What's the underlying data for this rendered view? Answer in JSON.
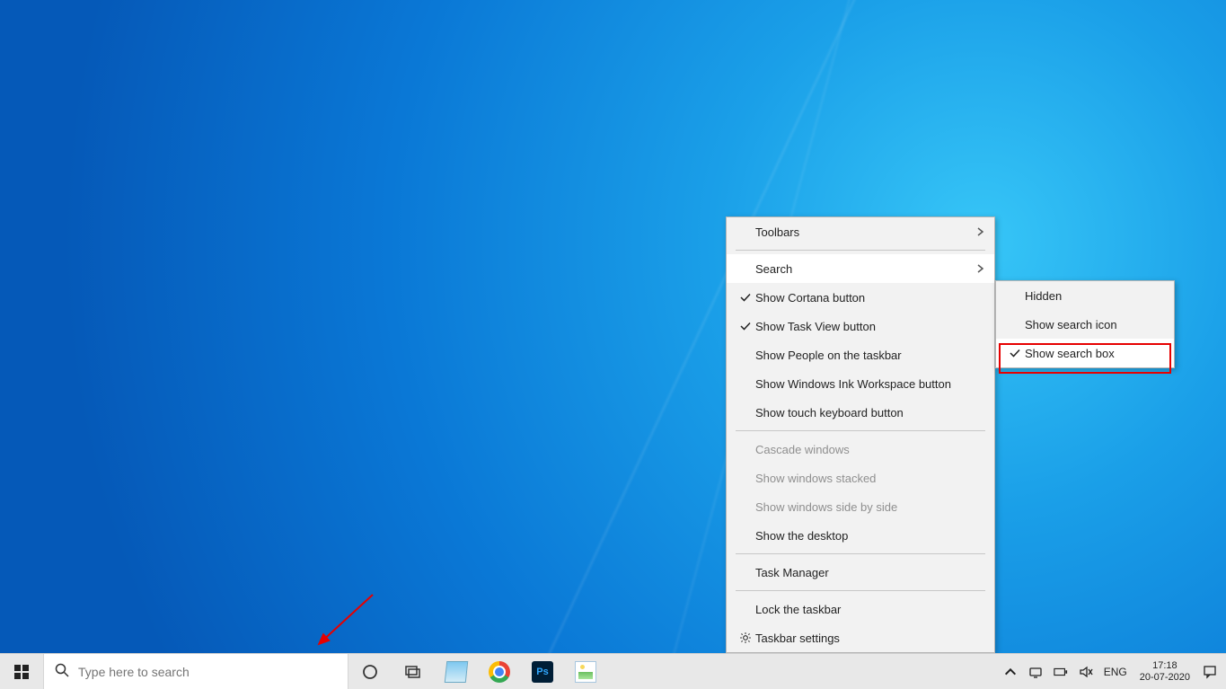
{
  "taskbar": {
    "search_placeholder": "Type here to search",
    "apps": [
      {
        "name": "notepad-app",
        "label": "Notepad"
      },
      {
        "name": "chrome-app",
        "label": "Google Chrome"
      },
      {
        "name": "photoshop-app",
        "label": "Ps"
      },
      {
        "name": "photos-app",
        "label": "Photos"
      }
    ]
  },
  "tray": {
    "language": "ENG",
    "time": "17:18",
    "date": "20-07-2020"
  },
  "context_menu": {
    "toolbars": "Toolbars",
    "search": "Search",
    "show_cortana": "Show Cortana button",
    "show_task_view": "Show Task View button",
    "show_people": "Show People on the taskbar",
    "show_ink": "Show Windows Ink Workspace button",
    "show_touch_kb": "Show touch keyboard button",
    "cascade": "Cascade windows",
    "stacked": "Show windows stacked",
    "side_by_side": "Show windows side by side",
    "show_desktop": "Show the desktop",
    "task_manager": "Task Manager",
    "lock_taskbar": "Lock the taskbar",
    "taskbar_settings": "Taskbar settings"
  },
  "search_submenu": {
    "hidden": "Hidden",
    "show_icon": "Show search icon",
    "show_box": "Show search box"
  }
}
